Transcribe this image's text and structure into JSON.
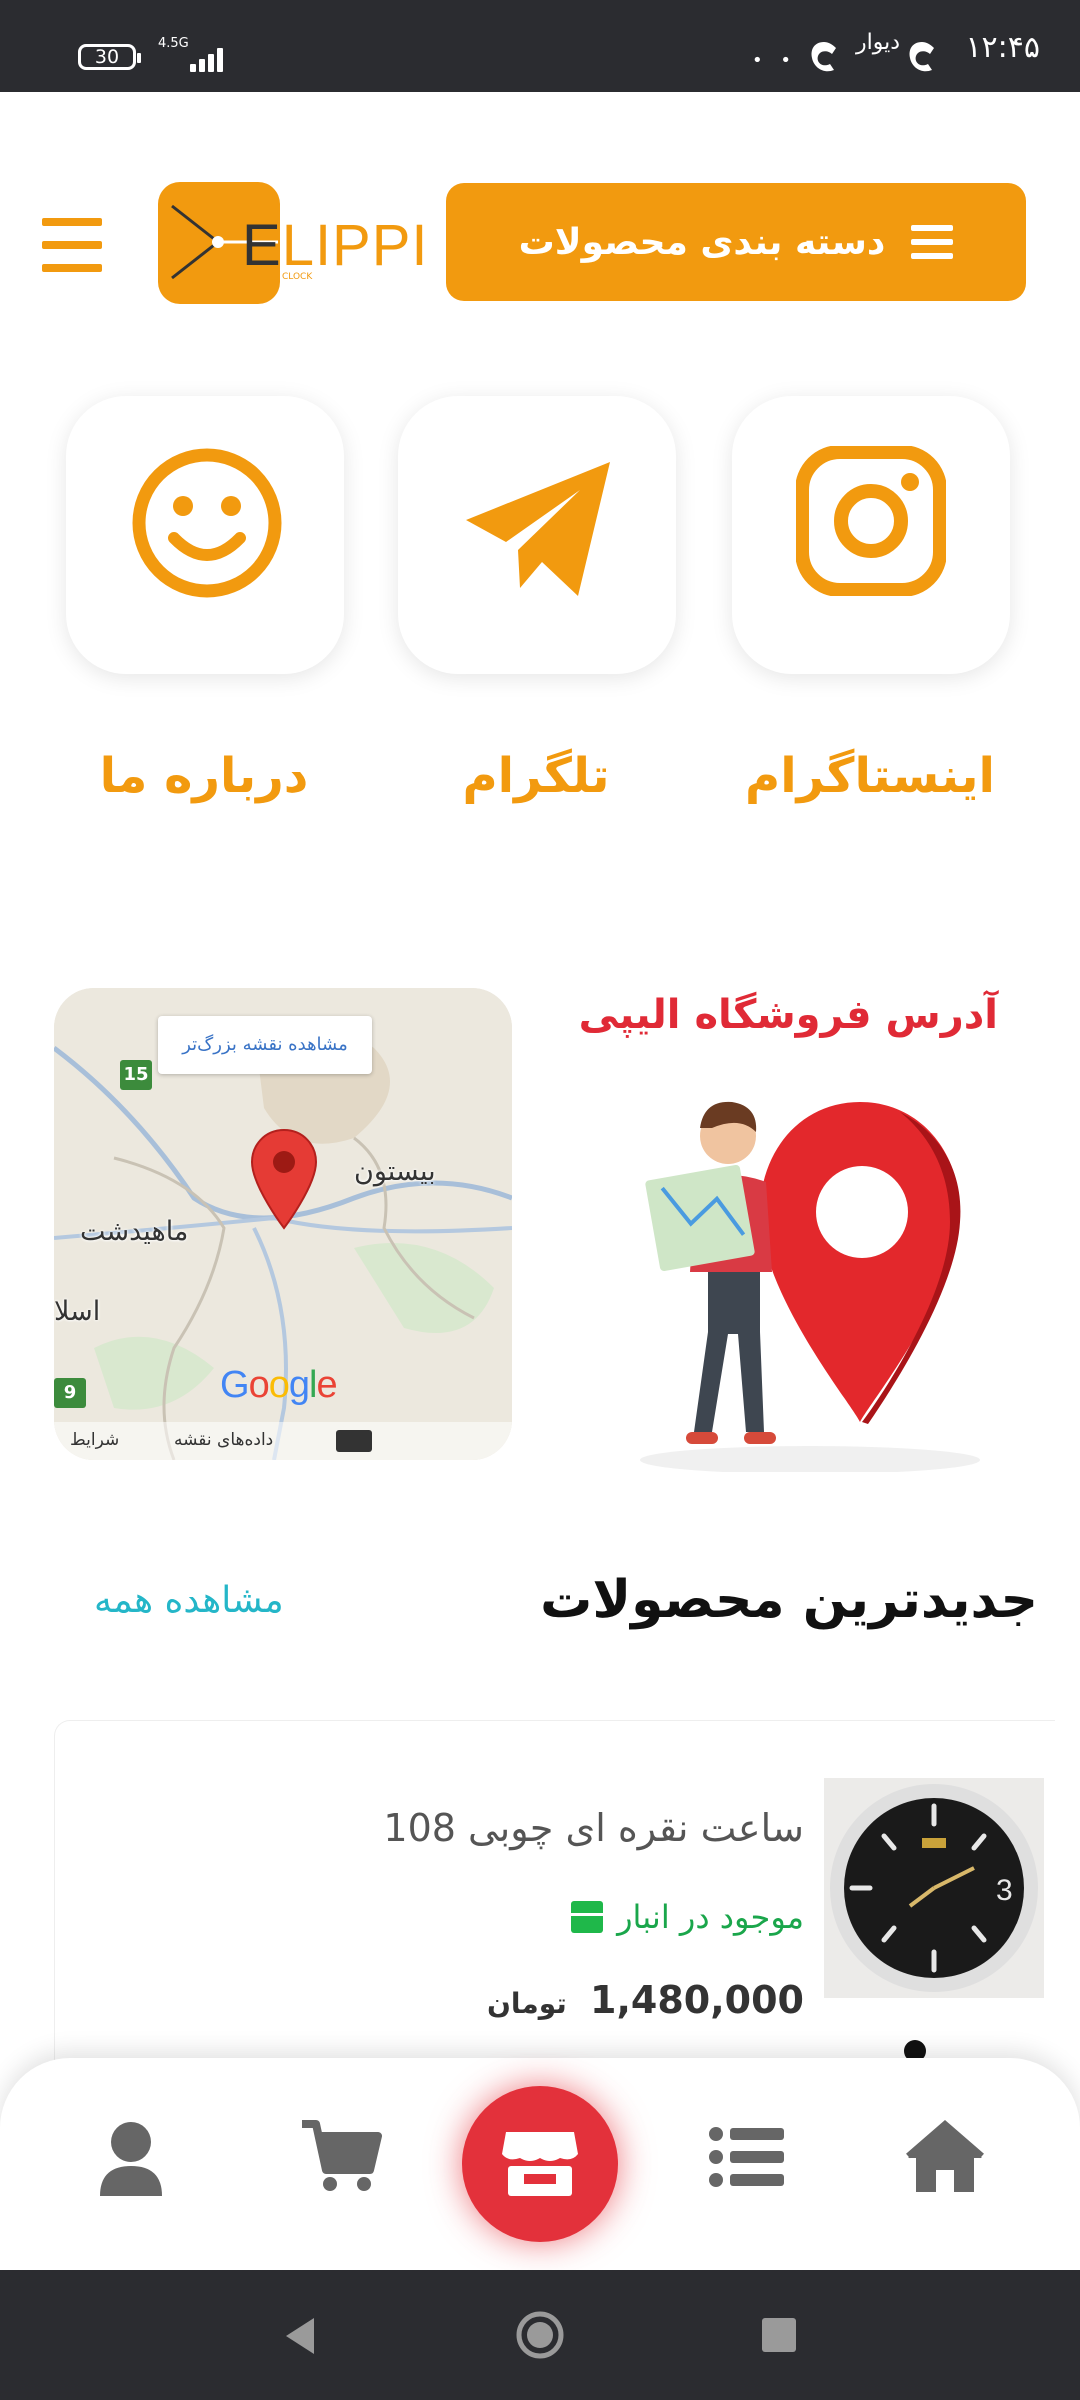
{
  "status_bar": {
    "time": "۱۲:۴۵",
    "app_label": "دیوار",
    "battery": "30",
    "network": "4.5G"
  },
  "header": {
    "logo_text": "LIPPI",
    "logo_initial": "E",
    "logo_subtext": "CLOCK",
    "categories_button": "دسته بندی محصولات"
  },
  "social": [
    {
      "label": "اینستاگرام",
      "icon": "instagram-icon"
    },
    {
      "label": "تلگرام",
      "icon": "telegram-icon"
    },
    {
      "label": "درباره ما",
      "icon": "smiley-icon"
    }
  ],
  "store": {
    "title": "آدرس فروشگاه الیپی",
    "map": {
      "view_larger": "مشاهده نقشه بزرگ‌تر",
      "places": [
        "بیستون",
        "ماهیدشت",
        "اسلا"
      ],
      "road_badges": [
        "15",
        "9"
      ],
      "brand": "Google",
      "map_data": "داده‌های نقشه",
      "terms": "شرایط"
    }
  },
  "latest": {
    "title": "جدیدترین محصولات",
    "see_all": "مشاهده همه",
    "products": [
      {
        "name": "ساعت نقره ای چوبی 108",
        "stock": "موجود در انبار",
        "price": "1,480,000",
        "currency": "تومان"
      }
    ]
  },
  "bottom_nav": [
    "home-icon",
    "list-icon",
    "store-icon",
    "cart-icon",
    "user-icon"
  ],
  "colors": {
    "accent": "#f29a0f",
    "red": "#e3313b",
    "teal": "#24b6c8",
    "green": "#1aa64b"
  }
}
